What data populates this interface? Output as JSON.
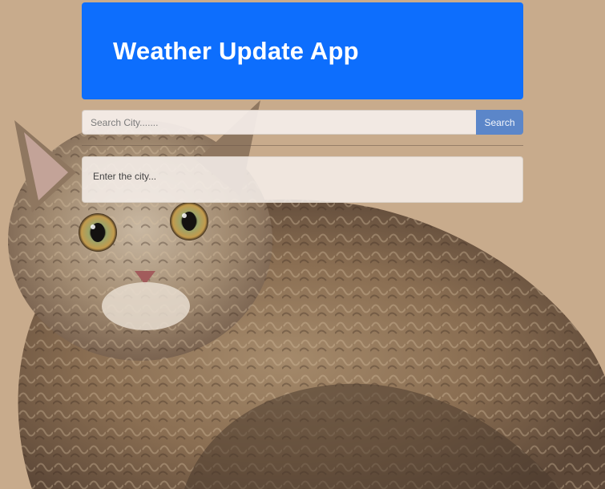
{
  "app": {
    "title": "Weather Update App"
  },
  "search": {
    "placeholder": "Search City.......",
    "button_label": "Search"
  },
  "result": {
    "message": "Enter the city..."
  },
  "colors": {
    "header_bg": "#0d6efd",
    "button_bg": "#5b86c9",
    "page_bg": "#c8ab8c"
  },
  "background": {
    "icon": "cat-photo-icon"
  }
}
